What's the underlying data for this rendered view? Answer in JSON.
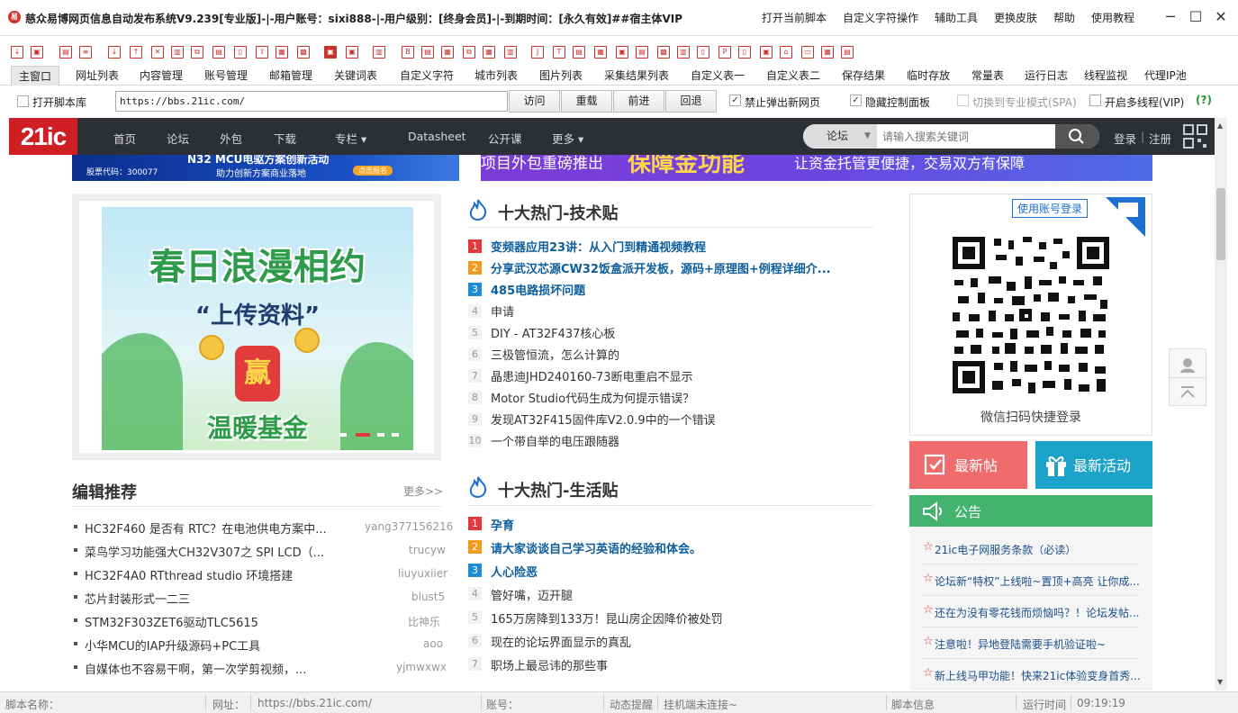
{
  "window": {
    "title": "慈众易博网页信息自动发布系统V9.239[专业版]-|-用户账号：sixi888-|-用户级别：[终身会员]-|-到期时间：[永久有效]##宿主体VIP",
    "menu": [
      "打开当前脚本",
      "自定义字符操作",
      "辅助工具",
      "更换皮肤",
      "帮助",
      "使用教程"
    ]
  },
  "tabs": [
    "主窗口",
    "网址列表",
    "内容管理",
    "账号管理",
    "邮箱管理",
    "关键词表",
    "自定义字符",
    "城市列表",
    "图片列表",
    "采集结果列表",
    "自定义表一",
    "自定义表二",
    "保存结果",
    "临时存放",
    "常量表",
    "运行日志",
    "线程监视",
    "代理IP池"
  ],
  "addressbar": {
    "open_script_lib": "打开脚本库",
    "url": "https://bbs.21ic.com/",
    "buttons": [
      "访问",
      "重载",
      "前进",
      "回退"
    ],
    "options": [
      {
        "label": "禁止弹出新网页",
        "checked": true
      },
      {
        "label": "隐藏控制面板",
        "checked": true
      },
      {
        "label": "切换到专业模式(SPA)",
        "checked": false
      },
      {
        "label": "开启多线程(VIP)",
        "checked": false
      }
    ],
    "help": "(?)"
  },
  "site": {
    "logo": "21ic",
    "nav": [
      "首页",
      "论坛",
      "外包",
      "下载",
      "专栏 ▾",
      "Datasheet",
      "公开课",
      "更多 ▾"
    ],
    "search_select": "论坛",
    "search_placeholder": "请输入搜索关键词",
    "login": "登录",
    "register": "注册",
    "banner_left": {
      "line1": "N32 MCU电驱方案创新活动",
      "line2": "助力创新方案商业落地",
      "stock": "股票代码：300077",
      "btn": "点击报名"
    },
    "banner_right": {
      "text1": "项目外包重磅推出",
      "text2": "保障金功能",
      "text3": "让资金托管更便捷，交易双方有保障"
    },
    "promo": {
      "title": "春日浪漫相约",
      "sub": "“上传资料”",
      "coin": "赢",
      "fund": "温暖基金"
    },
    "tech_hot": {
      "title": "十大热门-技术贴",
      "items": [
        "变频器应用23讲：从入门到精通视频教程",
        "分享武汉芯源CW32饭盒派开发板，源码+原理图+例程详细介...",
        "485电路损坏问题",
        "申请",
        "DIY - AT32F437核心板",
        "三极管恒流，怎么计算的",
        "晶患迪JHD240160-73断电重启不显示",
        "Motor Studio代码生成为何提示错误？",
        "发现AT32F415固件库V2.0.9中的一个错误",
        "一个带自举的电压跟随器"
      ]
    },
    "life_hot": {
      "title": "十大热门-生活贴",
      "items": [
        "孕育",
        "请大家谈谈自己学习英语的经验和体会。",
        "人心险恶",
        "管好嘴，迈开腿",
        "165万房降到133万！昆山房企因降价被处罚",
        "现在的论坛界面显示的真乱",
        "职场上最忌讳的那些事"
      ]
    },
    "editor": {
      "title": "编辑推荐",
      "more": "更多>>",
      "items": [
        {
          "title": "HC32F460 是否有 RTC？在电池供电方案中...",
          "author": "yang377156216"
        },
        {
          "title": "菜鸟学习功能强大CH32V307之 SPI LCD（...",
          "author": "trucyw"
        },
        {
          "title": "HC32F4A0 RTthread studio 环境搭建",
          "author": "liuyuxiier"
        },
        {
          "title": "芯片封装形式一二三",
          "author": "blust5"
        },
        {
          "title": "STM32F303ZET6驱动TLC5615",
          "author": "比神乐"
        },
        {
          "title": "小华MCU的IAP升级源码+PC工具",
          "author": "aoo"
        },
        {
          "title": "自媒体也不容易干啊，第一次学剪视频，...",
          "author": "yjmwxwx"
        }
      ]
    },
    "qr": {
      "badge": "使用账号登录",
      "caption": "微信扫码快捷登录"
    },
    "btn_newpost": "最新帖",
    "btn_activity": "最新活动",
    "notice": {
      "title": "公告",
      "items": [
        "21ic电子网服务条款（必读）",
        "论坛新“特权”上线啦~置顶+高亮 让你成...",
        "还在为没有零花钱而烦恼吗？！论坛发帖...",
        "注意啦！异地登陆需要手机验证啦~",
        "新上线马甲功能！快来21ic体验变身首秀..."
      ]
    }
  },
  "status": {
    "script_label": "脚本名称：",
    "url_label": "网址：",
    "url": "https://bbs.21ic.com/",
    "account_label": "账号：",
    "dyn_label": "动态提醒",
    "hook": "挂机端未连接~",
    "script_info": "脚本信息",
    "runtime_label": "运行时间",
    "runtime": "09:19:19"
  },
  "colors": {
    "accent": "#cf1f25",
    "nav_bg": "#2c2f33",
    "newpost": "#f06c6c",
    "activity": "#1ba3c9",
    "notice": "#43b36d"
  }
}
